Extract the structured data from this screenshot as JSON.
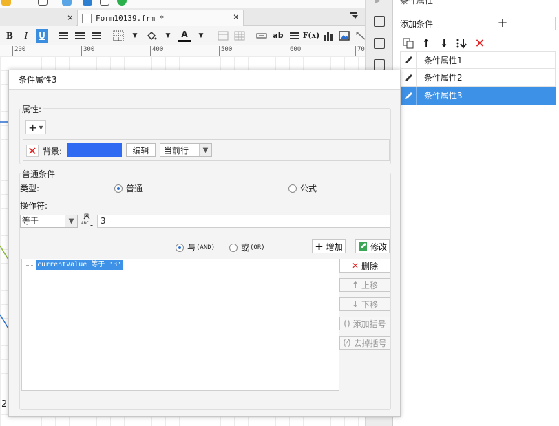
{
  "tabs": {
    "active_title": "Form10139.frm *",
    "close_glyph": "×"
  },
  "format_toolbar": {
    "bold": "B",
    "italic": "I",
    "underline": "U",
    "font_color": "A",
    "ab": "ab",
    "fx": "F(x)"
  },
  "ruler": {
    "ticks": [
      "200",
      "300",
      "400",
      "500",
      "600",
      "70"
    ]
  },
  "canvas": {
    "bottom_left_number": "2"
  },
  "right_panel": {
    "title": "条件属性",
    "add_condition_label": "添加条件",
    "add_button_glyph": "+",
    "items": [
      {
        "label": "条件属性1"
      },
      {
        "label": "条件属性2"
      },
      {
        "label": "条件属性3"
      }
    ],
    "selected_index": 2
  },
  "dialog": {
    "title": "条件属性3",
    "attributes": {
      "group_label": "属性:",
      "add_glyph": "+",
      "background_label": "背景:",
      "swatch_color": "#2f6bf2",
      "edit_label": "编辑",
      "scope_value": "当前行"
    },
    "condition": {
      "group_label": "普通条件",
      "type_label": "类型:",
      "type_normal": "普通",
      "type_formula": "公式",
      "type_selected": "普通",
      "operator_label": "操作符:",
      "operator_value": "等于",
      "operand_value": "3",
      "and_label": "与",
      "and_suffix": "(AND)",
      "or_label": "或",
      "or_suffix": "(OR)",
      "logic_selected": "与",
      "add_button": "增加",
      "modify_button": "修改",
      "delete_button": "删除",
      "move_up_button": "上移",
      "move_down_button": "下移",
      "add_bracket_button": "添加括号",
      "remove_bracket_button": "去掉括号",
      "expressions": [
        "currentValue 等于 '3'"
      ]
    }
  },
  "colors": {
    "selection_blue": "#3d91e6",
    "delete_red": "#e02020"
  }
}
